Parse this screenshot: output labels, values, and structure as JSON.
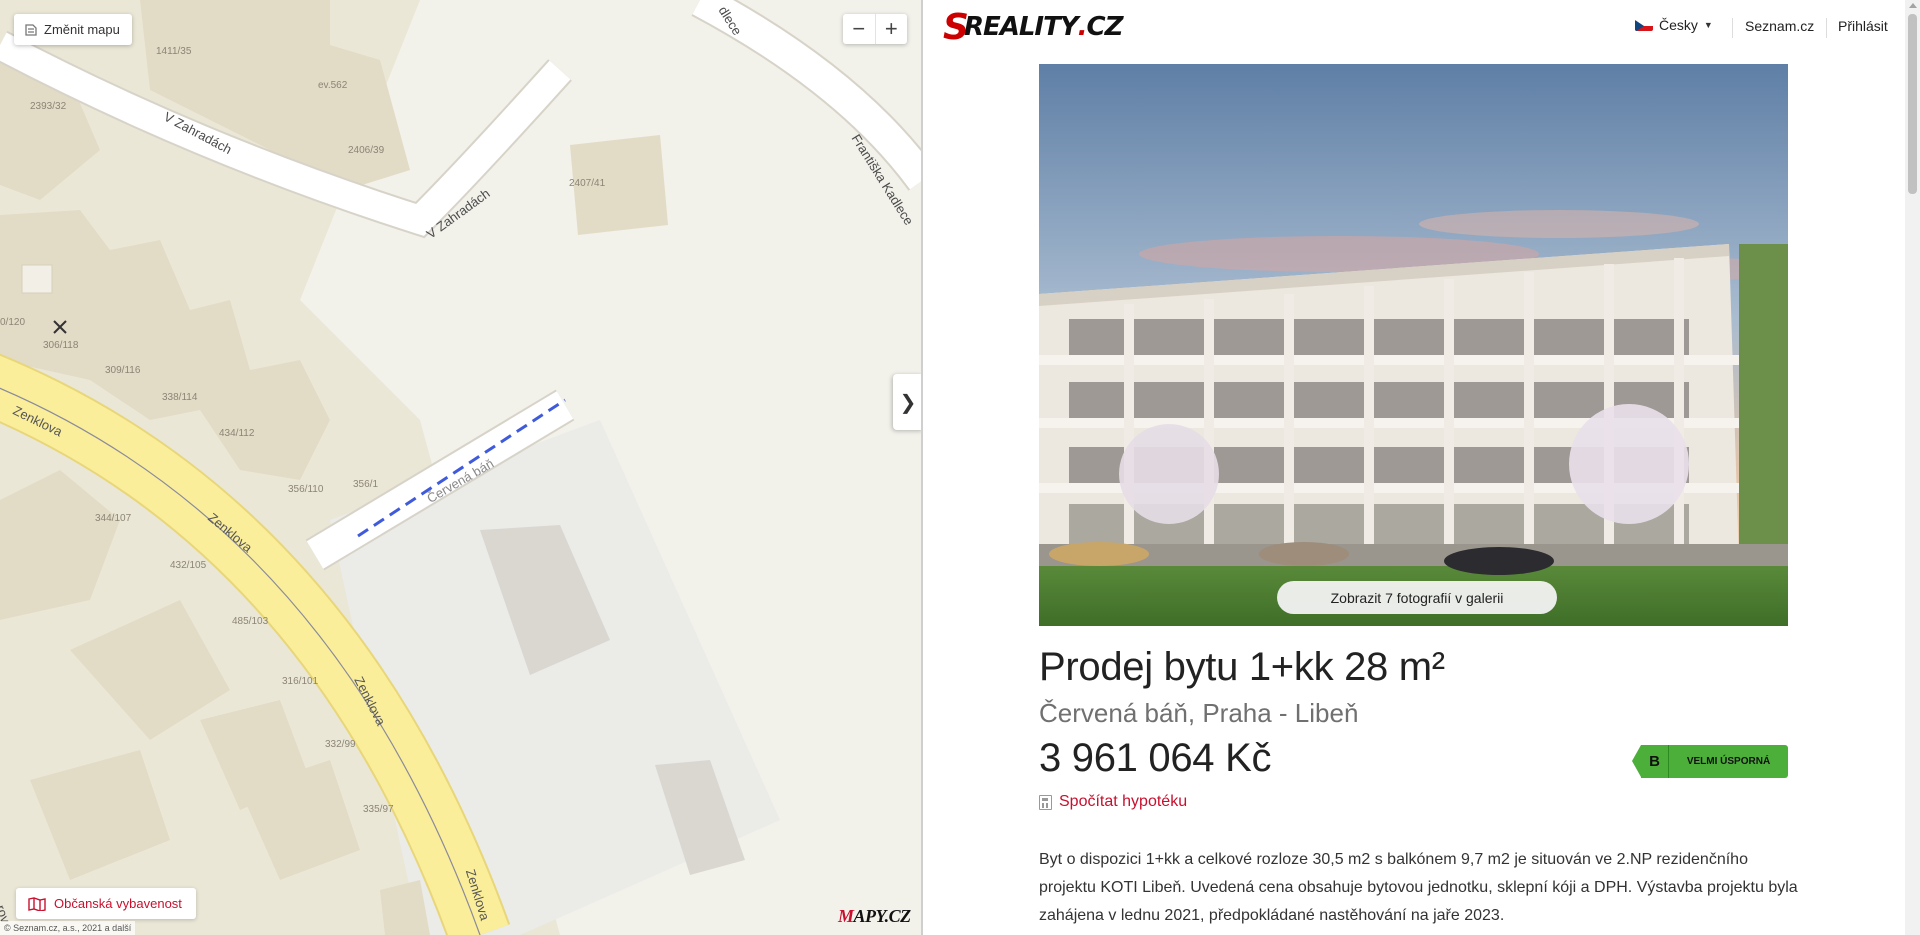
{
  "map": {
    "change_map_label": "Změnit mapu",
    "zoom_out": "−",
    "zoom_in": "+",
    "collapse_symbol": "❯",
    "poi_label": "Občanská vybavenost",
    "copyright": "© Seznam.cz, a.s., 2021 a další",
    "logo_m": "M",
    "logo_rest": "APY.CZ",
    "streets": {
      "v_zahradach_1": "V Zahradách",
      "v_zahradach_2": "V Zahradách",
      "frantiska_kadlece": "Františka Kadlece",
      "kadlece_top": "dlece",
      "zenklova_1": "Zenklova",
      "zenklova_2": "Zenklova",
      "zenklova_3": "Zenklova",
      "zenklova_4": "Zenklova",
      "cervena_ban": "Červená báň",
      "edge_rov": "rov"
    },
    "house_numbers": [
      "1411/35",
      "ev.562",
      "2393/32",
      "2406/39",
      "2407/41",
      "0/120",
      "306/118",
      "309/116",
      "338/114",
      "434/112",
      "356/110",
      "356/1",
      "344/107",
      "432/105",
      "485/103",
      "316/101",
      "332/99",
      "335/97"
    ]
  },
  "header": {
    "logo_s": "S",
    "logo_text": "REALITY",
    "logo_dot": ".",
    "logo_cz": "CZ",
    "language": "Česky",
    "seznam_link": "Seznam.cz",
    "login_link": "Přihlásit"
  },
  "listing": {
    "gallery_button": "Zobrazit 7 fotografií v galerii",
    "title": "Prodej bytu 1+kk 28 m²",
    "location": "Červená báň, Praha - Libeň",
    "price": "3 961 064 Kč",
    "energy_class": "B",
    "energy_label": "VELMI ÚSPORNÁ",
    "energy_color": "#4caf3a",
    "mortgage_link": "Spočítat hypotéku",
    "description": "Byt o dispozici 1+kk a celkové rozloze 30,5 m2 s balkónem 9,7 m2 je situován ve 2.NP rezidenčního projektu KOTI Libeň. Uvedená cena obsahuje bytovou jednotku, sklepní kóji a DPH. Výstavba projektu byla zahájena v lednu 2021, předpokládané nastěhování na jaře 2023."
  },
  "colors": {
    "accent_red": "#c8102e",
    "map_background": "#ebe7d7",
    "main_road": "#fbee9a"
  }
}
